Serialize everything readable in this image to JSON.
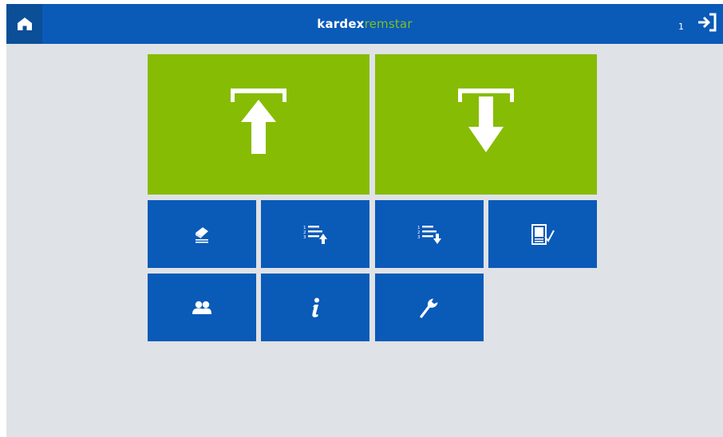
{
  "header": {
    "brand_primary": "kardex",
    "brand_secondary": "remstar",
    "user_count": "1",
    "home_icon": "home-icon",
    "logout_icon": "logout-icon"
  },
  "tiles": {
    "put": {
      "icon": "put-arrow-up-icon"
    },
    "pick": {
      "icon": "pick-arrow-down-icon"
    },
    "clear": {
      "icon": "eraser-icon"
    },
    "list_put": {
      "icon": "numbered-list-up-icon"
    },
    "list_pick": {
      "icon": "numbered-list-down-icon"
    },
    "inventory": {
      "icon": "document-check-icon"
    },
    "users": {
      "icon": "users-icon"
    },
    "info": {
      "icon": "info-icon"
    },
    "service": {
      "icon": "wrench-icon"
    }
  },
  "colors": {
    "header_blue": "#0a5ab8",
    "home_blue": "#0b4f98",
    "tile_green": "#86bc03",
    "tile_blue": "#0a5ab8",
    "brand_green": "#7fc11d",
    "background": "#dfe2e6"
  }
}
